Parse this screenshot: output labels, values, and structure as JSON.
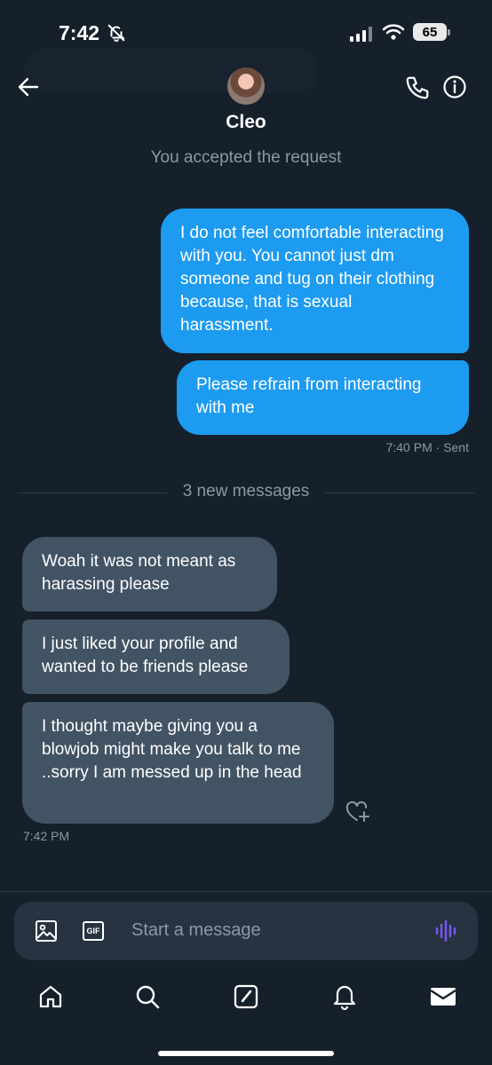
{
  "status": {
    "time": "7:42",
    "battery": "65"
  },
  "header": {
    "name": "Cleo",
    "accepted_text": "You accepted the request"
  },
  "messages": {
    "sent": [
      "I do not feel comfortable interacting with you. You cannot just dm someone and tug on their clothing because, that is sexual harassment.",
      "Please refrain from interacting with me"
    ],
    "sent_time": "7:40 PM",
    "sent_status": "Sent",
    "new_messages_label": "3 new messages",
    "received": [
      "Woah it was not meant as harassing please",
      "I just liked your profile and wanted to be friends please",
      "I thought maybe giving you a blowjob might make you talk to me ..sorry I am messed up in the head"
    ],
    "received_time": "7:42 PM"
  },
  "composer": {
    "placeholder": "Start a message",
    "gif_label": "GIF"
  },
  "colors": {
    "accent": "#1d9bf0",
    "background": "#15202b",
    "received_bubble": "#425364",
    "voice_icon": "#7856ff"
  },
  "icons": [
    "back-arrow-icon",
    "phone-icon",
    "info-icon",
    "heart-plus-icon",
    "image-icon",
    "gif-icon",
    "voice-icon",
    "home-icon",
    "search-icon",
    "compose-icon",
    "bell-icon",
    "mail-icon"
  ]
}
